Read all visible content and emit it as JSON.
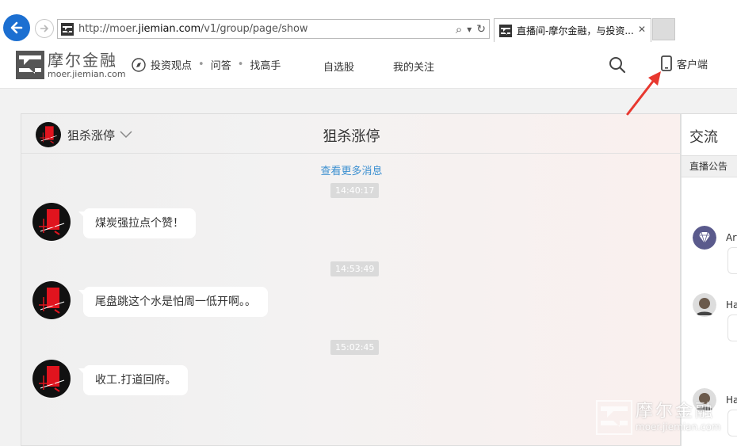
{
  "browser": {
    "url_prefix": "http://moer.",
    "url_domain": "jiemian.com",
    "url_path": "/v1/group/page/show",
    "search_glyph": "⌕",
    "dropdown_glyph": "▾",
    "refresh_glyph": "↻",
    "tab_title": "直播间-摩尔金融，与投资...",
    "tab_close": "✕"
  },
  "site": {
    "logo_cn": "摩尔金融",
    "logo_en": "moer.jiemian.com",
    "nav": [
      "投资观点",
      "问答",
      "找高手"
    ],
    "nav_sep": "•",
    "nav_right": [
      "自选股",
      "我的关注"
    ],
    "client_label": "客户端"
  },
  "chat": {
    "channel_name": "狙杀涨停",
    "title": "狙杀涨停",
    "load_more": "查看更多消息",
    "messages": [
      {
        "time": "14:40:17",
        "text": "煤炭强拉点个赞！"
      },
      {
        "time": "14:53:49",
        "text": "尾盘跳这个水是怕周一低开啊。。"
      },
      {
        "time": "15:02:45",
        "text": "收工.打道回府。"
      }
    ]
  },
  "side": {
    "title": "交流",
    "tab": "直播公告",
    "users": [
      "Art",
      "Ha",
      "Ha"
    ]
  },
  "watermark": {
    "cn": "摩尔金融",
    "en": "moer.jiemian.com"
  },
  "colors": {
    "back_button": "#1c6fd1",
    "link": "#3a8fd0",
    "arrow": "#e8382f",
    "avatar_red": "#e0141e"
  }
}
